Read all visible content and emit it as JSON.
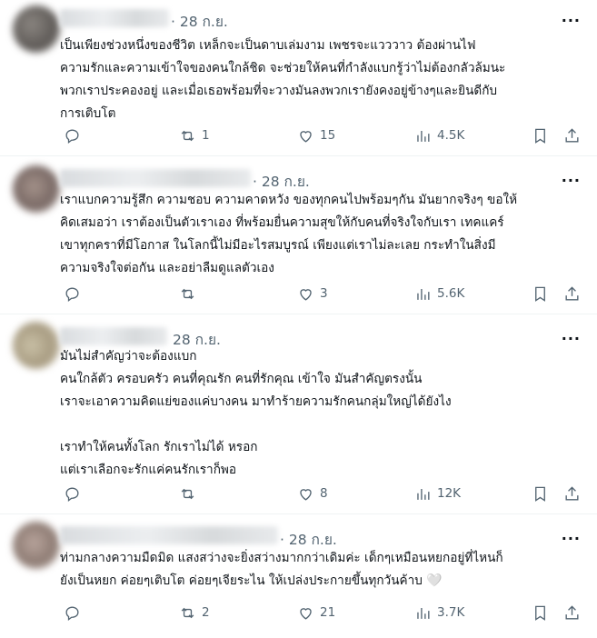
{
  "tweets": [
    {
      "date": "· 28 ก.ย.",
      "text": "เป็นเพียงช่วงหนึ่งของชีวิต เหล็กจะเป็นดาบเล่มงาม เพชรจะแวววาว ต้องผ่านไฟ\n ความรักและความเข้าใจของคนใกล้ชิด จะช่วยให้คนที่กำลังแบกรู้ว่าไม่ต้องกลัวล้มนะ\nพวกเราประคองอยู่ และเมื่อเธอพร้อมที่จะวางมันลงพวกเรายังคงอยู่ข้างๆและยินดีกับ\nการเติบโต",
      "reply_count": "",
      "retweet_count": "1",
      "like_count": "15",
      "view_count": "4.5K"
    },
    {
      "date": "· 28 ก.ย.",
      "text": "เราแบกความรู้สึก ความชอบ ความคาดหวัง ของทุกคนไปพร้อมๆกัน มันยากจริงๆ ขอให้\nคิดเสมอว่า เราต้องเป็นตัวเราเอง ที่พร้อมยื่นความสุขให้กับคนที่จริงใจกับเรา เทคแคร์\nเขาทุกคราที่มีโอกาส ในโลกนี้ไม่มีอะไรสมบูรณ์ เพียงแต่เราไม่ละเลย กระทำในสิ่งมี\nความจริงใจต่อกัน และอย่าลืมดูแลตัวเอง",
      "reply_count": "",
      "retweet_count": "",
      "like_count": "3",
      "view_count": "5.6K"
    },
    {
      "date": "28 ก.ย.",
      "text": "มันไม่สำคัญว่าจะต้องแบก\nคนใกล้ตัว ครอบครัว คนที่คุณรัก คนที่รักคุณ เข้าใจ มันสำคัญตรงนั้น\nเราจะเอาความคิดแย่ของแค่บางคน มาทำร้ายความรักคนกลุ่มใหญ่ได้ยังไง\n\nเราทำให้คนทั้งโลก รักเราไม่ได้ หรอก\nแต่เราเลือกจะรักแค่คนรักเราก็พอ",
      "reply_count": "",
      "retweet_count": "",
      "like_count": "8",
      "view_count": "12K"
    },
    {
      "date": "· 28 ก.ย.",
      "text": "ท่ามกลางความมืดมิด แสงสว่างจะยิ่งสว่างมากกว่าเดิมค่ะ เด็กๆเหมือนหยกอยู่ที่ไหนก็\nยังเป็นหยก ค่อยๆเติบโต ค่อยๆเจียระไน ให้เปล่งประกายขึ้นทุกวันค้าบ",
      "emoji": "🤍",
      "reply_count": "",
      "retweet_count": "2",
      "like_count": "21",
      "view_count": "3.7K"
    }
  ],
  "colors": {
    "text": "#0f1419",
    "secondary": "#536471",
    "divider": "#eff3f4"
  },
  "icons": [
    "reply-icon",
    "retweet-icon",
    "like-icon",
    "views-icon",
    "bookmark-icon",
    "share-icon",
    "more-icon"
  ]
}
